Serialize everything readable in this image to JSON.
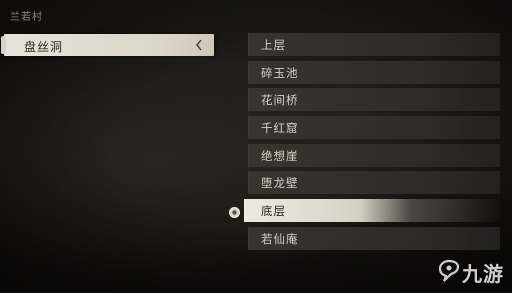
{
  "region": {
    "label": "兰若村"
  },
  "left_menu": {
    "selected_item": "盘丝洞",
    "collapse_icon": "chevron-left-icon"
  },
  "locations": [
    {
      "label": "上层",
      "selected": false
    },
    {
      "label": "碎玉池",
      "selected": false
    },
    {
      "label": "花间桥",
      "selected": false
    },
    {
      "label": "千红窟",
      "selected": false
    },
    {
      "label": "绝想崖",
      "selected": false
    },
    {
      "label": "堕龙壁",
      "selected": false
    },
    {
      "label": "底层",
      "selected": true
    },
    {
      "label": "若仙庵",
      "selected": false
    }
  ],
  "watermark": {
    "text": "九游",
    "icon": "jiuyou-logo-icon"
  },
  "colors": {
    "background": "#141210",
    "selected_bg": "#e8e3d8",
    "row_bg": "#3a3632",
    "text_light": "#d7d1c4",
    "text_dark": "#2a2622"
  }
}
